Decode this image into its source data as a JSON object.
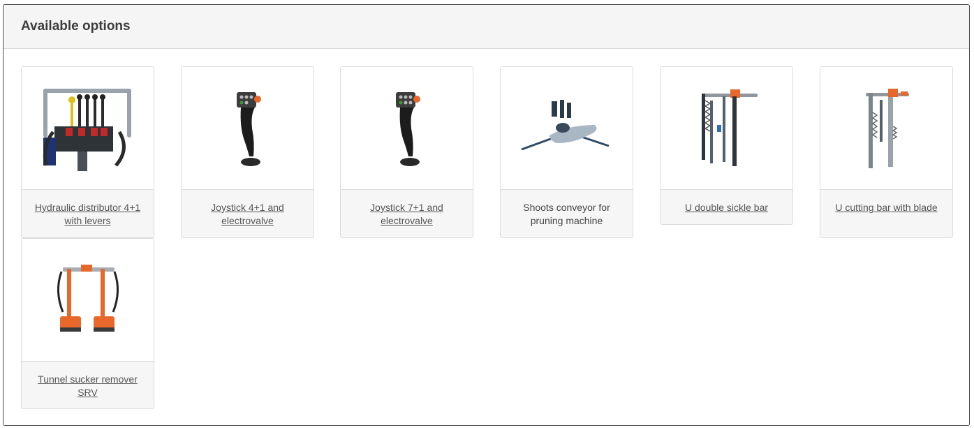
{
  "panel": {
    "title": "Available options"
  },
  "options": [
    {
      "label": "Hydraulic distributor 4+1 with levers",
      "linked": true,
      "icon": "hydraulic-distributor-image"
    },
    {
      "label": "Joystick 4+1 and electrovalve",
      "linked": true,
      "icon": "joystick-image"
    },
    {
      "label": "Joystick 7+1 and electrovalve",
      "linked": true,
      "icon": "joystick-image"
    },
    {
      "label": "Shoots conveyor for pruning machine",
      "linked": false,
      "icon": "shoots-conveyor-image"
    },
    {
      "label": "U double sickle bar",
      "linked": true,
      "icon": "double-sickle-bar-image"
    },
    {
      "label": "U cutting bar with blade",
      "linked": true,
      "icon": "cutting-bar-image"
    },
    {
      "label": "Tunnel sucker remover SRV",
      "linked": true,
      "icon": "tunnel-sucker-remover-image"
    }
  ],
  "colors": {
    "accent_orange": "#e8672a",
    "text": "#555555",
    "header_bg": "#f5f5f5"
  }
}
